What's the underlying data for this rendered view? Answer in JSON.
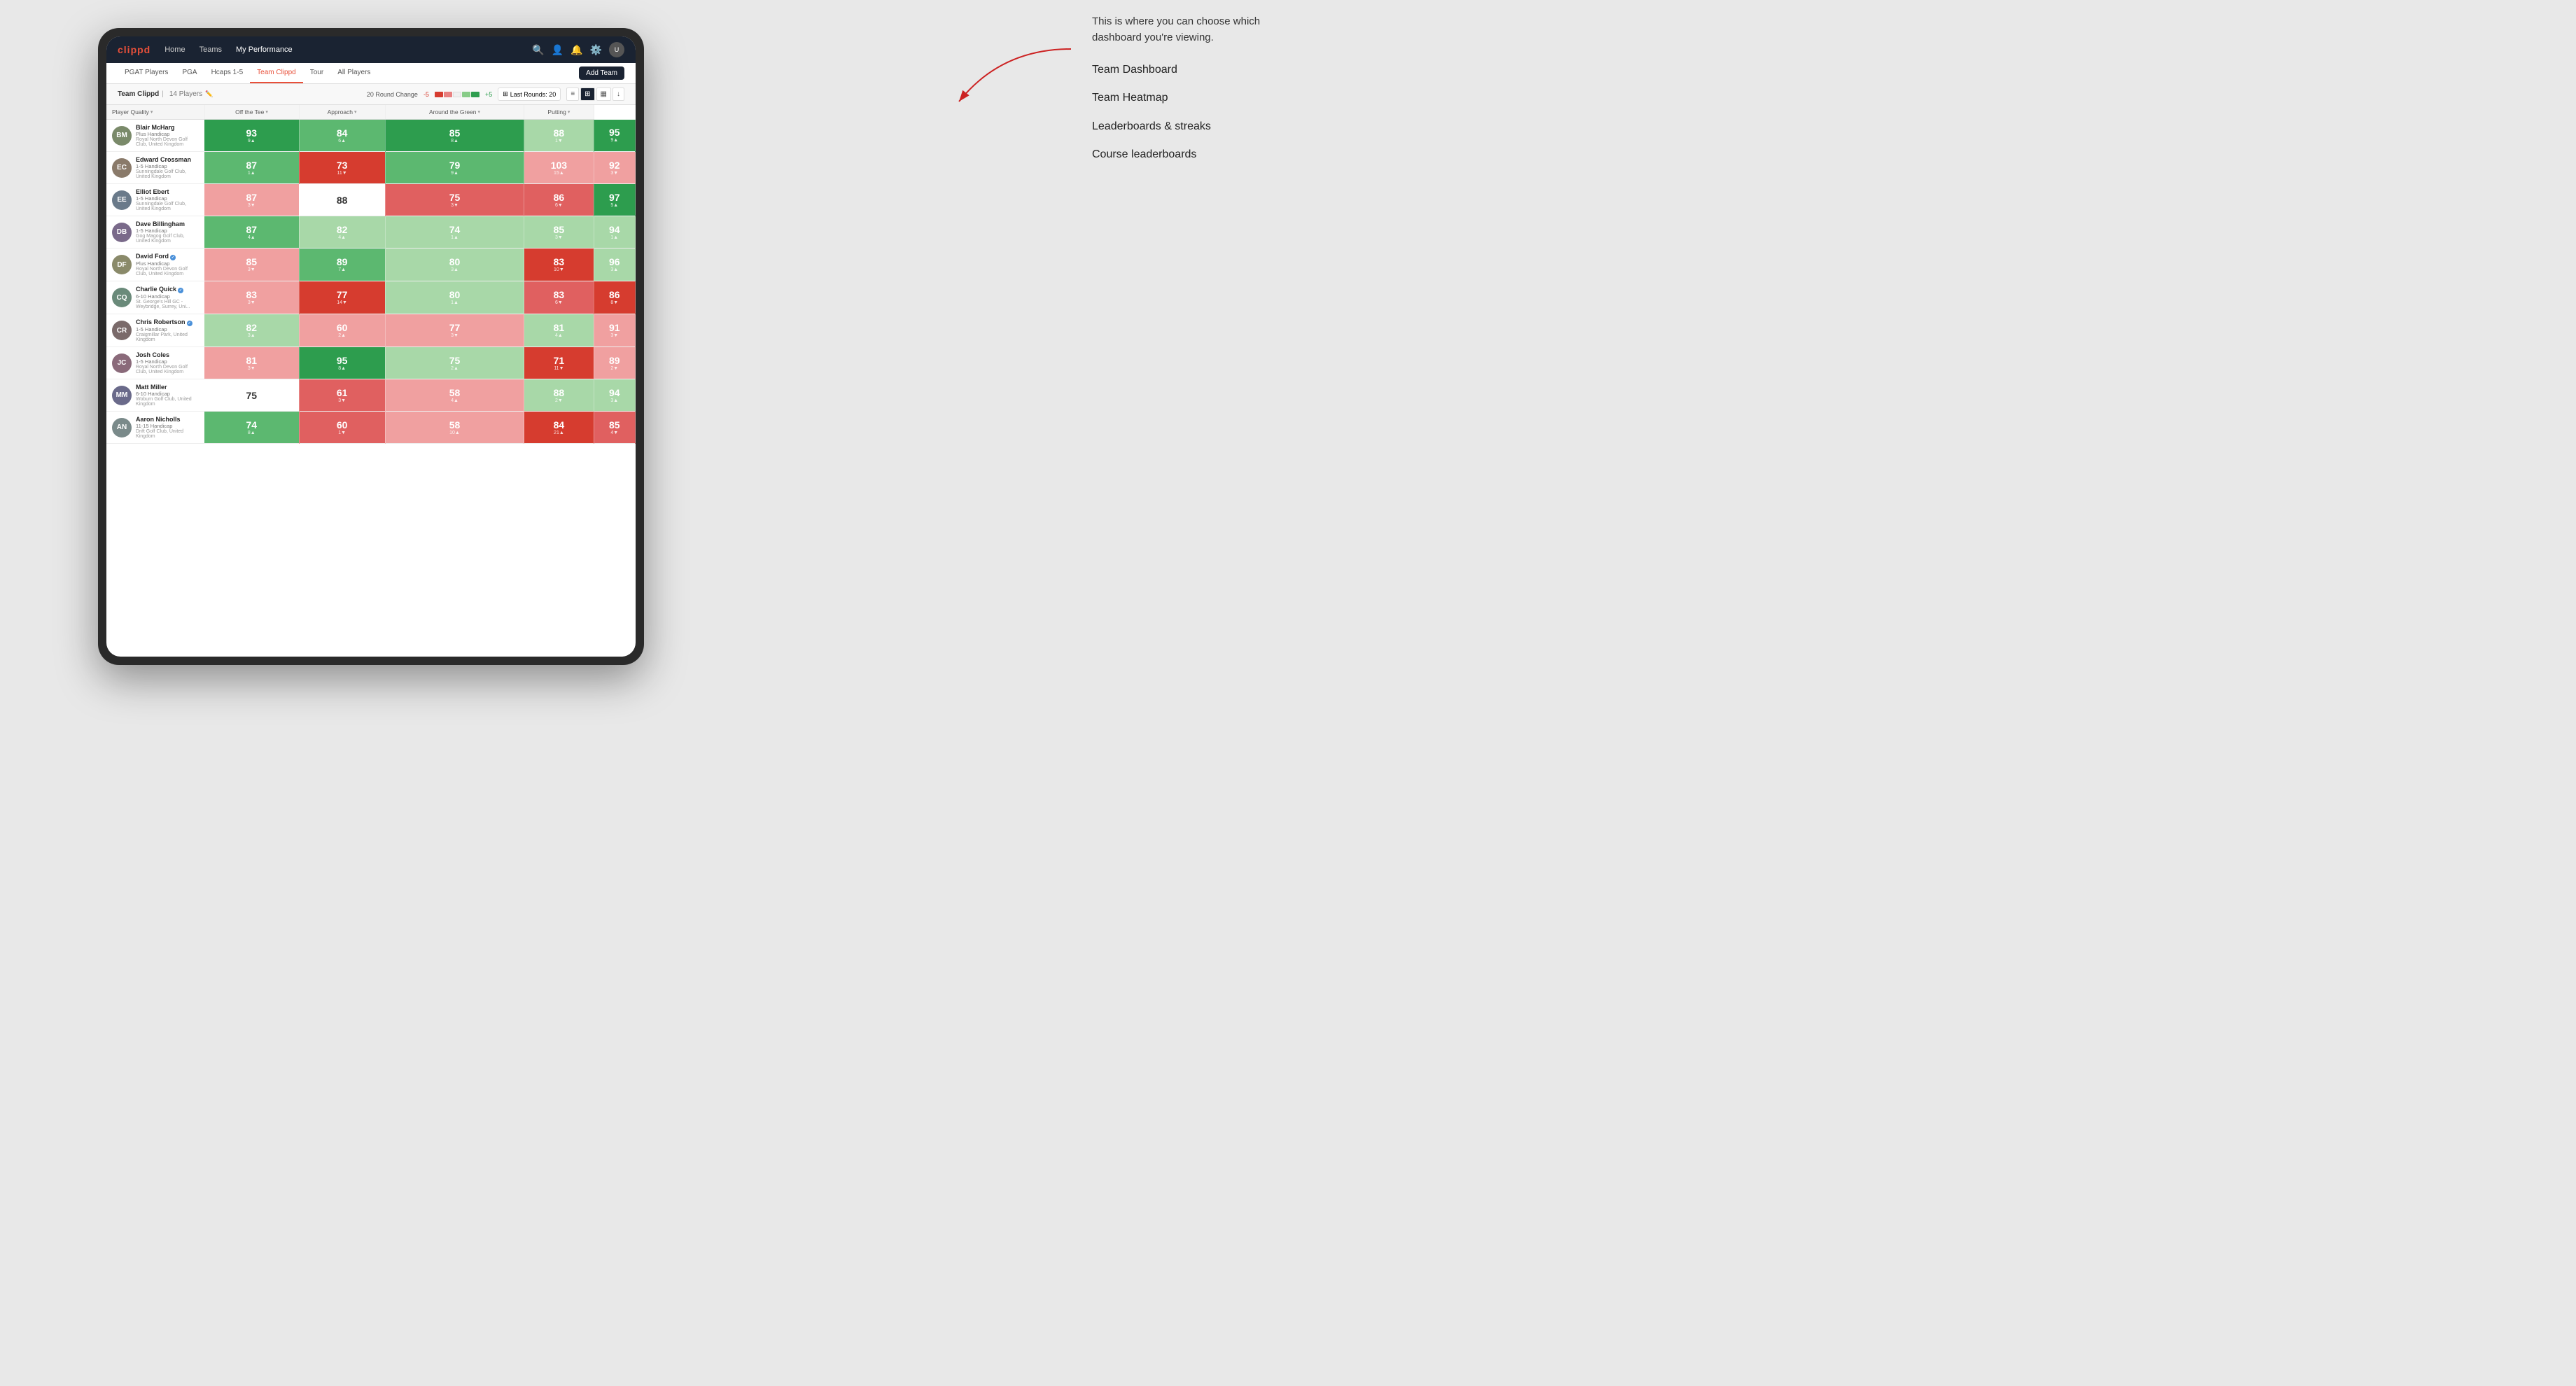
{
  "annotation": {
    "intro": "This is where you can choose which dashboard you're viewing.",
    "menu_items": [
      "Team Dashboard",
      "Team Heatmap",
      "Leaderboards & streaks",
      "Course leaderboards"
    ]
  },
  "nav": {
    "logo": "clippd",
    "links": [
      "Home",
      "Teams",
      "My Performance"
    ],
    "active_link": "My Performance"
  },
  "sub_nav": {
    "tabs": [
      "PGAT Players",
      "PGA",
      "Hcaps 1-5",
      "Team Clippd",
      "Tour",
      "All Players"
    ],
    "active_tab": "Team Clippd",
    "add_team_label": "Add Team"
  },
  "team_header": {
    "name": "Team Clippd",
    "separator": "|",
    "count": "14 Players",
    "round_change_label": "20 Round Change",
    "change_from": "-5",
    "change_to": "+5",
    "last_rounds_label": "Last Rounds:",
    "last_rounds_value": "20"
  },
  "table": {
    "columns": [
      "Player Quality ▾",
      "Off the Tee ▾",
      "Approach ▾",
      "Around the Green ▾",
      "Putting ▾"
    ],
    "players": [
      {
        "name": "Blair McHarg",
        "handicap": "Plus Handicap",
        "club": "Royal North Devon Golf Club, United Kingdom",
        "avatar_color": "#7a8a6a",
        "initials": "BM",
        "stats": [
          {
            "value": "93",
            "change": "9▲",
            "bg": "bg-green-strong",
            "dark": false
          },
          {
            "value": "84",
            "change": "6▲",
            "bg": "bg-green-mid",
            "dark": false
          },
          {
            "value": "85",
            "change": "8▲",
            "bg": "bg-green-strong",
            "dark": false
          },
          {
            "value": "88",
            "change": "1▼",
            "bg": "bg-green-light",
            "dark": false
          },
          {
            "value": "95",
            "change": "9▲",
            "bg": "bg-green-strong",
            "dark": false
          }
        ]
      },
      {
        "name": "Edward Crossman",
        "handicap": "1-5 Handicap",
        "club": "Sunningdale Golf Club, United Kingdom",
        "avatar_color": "#8a7a6a",
        "initials": "EC",
        "stats": [
          {
            "value": "87",
            "change": "1▲",
            "bg": "bg-green-mid",
            "dark": false
          },
          {
            "value": "73",
            "change": "11▼",
            "bg": "bg-red-strong",
            "dark": false
          },
          {
            "value": "79",
            "change": "9▲",
            "bg": "bg-green-mid",
            "dark": false
          },
          {
            "value": "103",
            "change": "15▲",
            "bg": "bg-red-light",
            "dark": false
          },
          {
            "value": "92",
            "change": "3▼",
            "bg": "bg-red-light",
            "dark": false
          }
        ]
      },
      {
        "name": "Elliot Ebert",
        "handicap": "1-5 Handicap",
        "club": "Sunningdale Golf Club, United Kingdom",
        "avatar_color": "#6a7a8a",
        "initials": "EE",
        "stats": [
          {
            "value": "87",
            "change": "3▼",
            "bg": "bg-red-light",
            "dark": false
          },
          {
            "value": "88",
            "change": "",
            "bg": "bg-white",
            "dark": true
          },
          {
            "value": "75",
            "change": "3▼",
            "bg": "bg-red-mid",
            "dark": false
          },
          {
            "value": "86",
            "change": "6▼",
            "bg": "bg-red-mid",
            "dark": false
          },
          {
            "value": "97",
            "change": "5▲",
            "bg": "bg-green-strong",
            "dark": false
          }
        ]
      },
      {
        "name": "Dave Billingham",
        "handicap": "1-5 Handicap",
        "club": "Gog Magog Golf Club, United Kingdom",
        "avatar_color": "#7a6a8a",
        "initials": "DB",
        "stats": [
          {
            "value": "87",
            "change": "4▲",
            "bg": "bg-green-mid",
            "dark": false
          },
          {
            "value": "82",
            "change": "4▲",
            "bg": "bg-green-light",
            "dark": false
          },
          {
            "value": "74",
            "change": "1▲",
            "bg": "bg-green-light",
            "dark": false
          },
          {
            "value": "85",
            "change": "3▼",
            "bg": "bg-green-light",
            "dark": false
          },
          {
            "value": "94",
            "change": "1▲",
            "bg": "bg-green-light",
            "dark": false
          }
        ]
      },
      {
        "name": "David Ford",
        "handicap": "Plus Handicap",
        "club": "Royal North Devon Golf Club, United Kingdom",
        "avatar_color": "#8a8a6a",
        "initials": "DF",
        "verified": true,
        "stats": [
          {
            "value": "85",
            "change": "3▼",
            "bg": "bg-red-light",
            "dark": false
          },
          {
            "value": "89",
            "change": "7▲",
            "bg": "bg-green-mid",
            "dark": false
          },
          {
            "value": "80",
            "change": "3▲",
            "bg": "bg-green-light",
            "dark": false
          },
          {
            "value": "83",
            "change": "10▼",
            "bg": "bg-red-strong",
            "dark": false
          },
          {
            "value": "96",
            "change": "3▲",
            "bg": "bg-green-light",
            "dark": false
          }
        ]
      },
      {
        "name": "Charlie Quick",
        "handicap": "6-10 Handicap",
        "club": "St. George's Hill GC - Weybridge, Surrey, Uni...",
        "avatar_color": "#6a8a7a",
        "initials": "CQ",
        "verified": true,
        "stats": [
          {
            "value": "83",
            "change": "3▼",
            "bg": "bg-red-light",
            "dark": false
          },
          {
            "value": "77",
            "change": "14▼",
            "bg": "bg-red-strong",
            "dark": false
          },
          {
            "value": "80",
            "change": "1▲",
            "bg": "bg-green-light",
            "dark": false
          },
          {
            "value": "83",
            "change": "6▼",
            "bg": "bg-red-mid",
            "dark": false
          },
          {
            "value": "86",
            "change": "8▼",
            "bg": "bg-red-strong",
            "dark": false
          }
        ]
      },
      {
        "name": "Chris Robertson",
        "handicap": "1-5 Handicap",
        "club": "Craigmillar Park, United Kingdom",
        "avatar_color": "#7a6a6a",
        "initials": "CR",
        "verified": true,
        "stats": [
          {
            "value": "82",
            "change": "3▲",
            "bg": "bg-green-light",
            "dark": false
          },
          {
            "value": "60",
            "change": "2▲",
            "bg": "bg-red-light",
            "dark": false
          },
          {
            "value": "77",
            "change": "3▼",
            "bg": "bg-red-light",
            "dark": false
          },
          {
            "value": "81",
            "change": "4▲",
            "bg": "bg-green-light",
            "dark": false
          },
          {
            "value": "91",
            "change": "3▼",
            "bg": "bg-red-light",
            "dark": false
          }
        ]
      },
      {
        "name": "Josh Coles",
        "handicap": "1-5 Handicap",
        "club": "Royal North Devon Golf Club, United Kingdom",
        "avatar_color": "#8a6a7a",
        "initials": "JC",
        "stats": [
          {
            "value": "81",
            "change": "3▼",
            "bg": "bg-red-light",
            "dark": false
          },
          {
            "value": "95",
            "change": "8▲",
            "bg": "bg-green-strong",
            "dark": false
          },
          {
            "value": "75",
            "change": "2▲",
            "bg": "bg-green-light",
            "dark": false
          },
          {
            "value": "71",
            "change": "11▼",
            "bg": "bg-red-strong",
            "dark": false
          },
          {
            "value": "89",
            "change": "2▼",
            "bg": "bg-red-light",
            "dark": false
          }
        ]
      },
      {
        "name": "Matt Miller",
        "handicap": "6-10 Handicap",
        "club": "Woburn Golf Club, United Kingdom",
        "avatar_color": "#6a6a8a",
        "initials": "MM",
        "stats": [
          {
            "value": "75",
            "change": "",
            "bg": "bg-white",
            "dark": true
          },
          {
            "value": "61",
            "change": "3▼",
            "bg": "bg-red-mid",
            "dark": false
          },
          {
            "value": "58",
            "change": "4▲",
            "bg": "bg-red-light",
            "dark": false
          },
          {
            "value": "88",
            "change": "2▼",
            "bg": "bg-green-light",
            "dark": false
          },
          {
            "value": "94",
            "change": "3▲",
            "bg": "bg-green-light",
            "dark": false
          }
        ]
      },
      {
        "name": "Aaron Nicholls",
        "handicap": "11-15 Handicap",
        "club": "Drift Golf Club, United Kingdom",
        "avatar_color": "#7a8a8a",
        "initials": "AN",
        "stats": [
          {
            "value": "74",
            "change": "8▲",
            "bg": "bg-green-mid",
            "dark": false
          },
          {
            "value": "60",
            "change": "1▼",
            "bg": "bg-red-mid",
            "dark": false
          },
          {
            "value": "58",
            "change": "10▲",
            "bg": "bg-red-light",
            "dark": false
          },
          {
            "value": "84",
            "change": "21▲",
            "bg": "bg-red-strong",
            "dark": false
          },
          {
            "value": "85",
            "change": "4▼",
            "bg": "bg-red-mid",
            "dark": false
          }
        ]
      }
    ]
  }
}
